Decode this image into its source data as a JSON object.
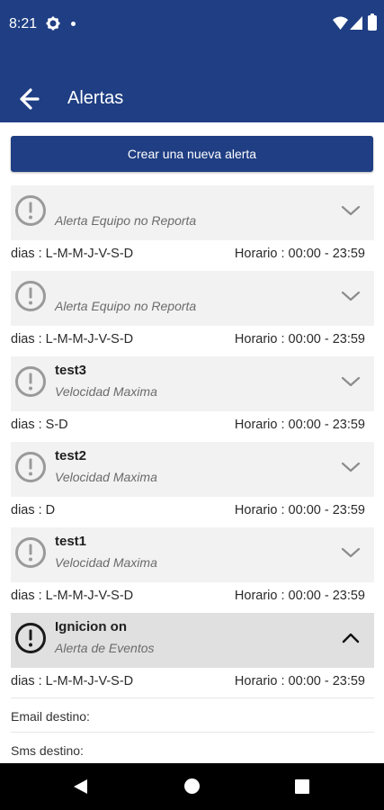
{
  "status_bar": {
    "time": "8:21"
  },
  "toolbar": {
    "title": "Alertas"
  },
  "create_button": {
    "label": "Crear una nueva alerta"
  },
  "alerts": [
    {
      "name": "",
      "type": "Alerta Equipo no Reporta",
      "days": "dias : L-M-M-J-V-S-D",
      "hours": "Horario : 00:00 - 23:59",
      "expanded": false
    },
    {
      "name": "",
      "type": "Alerta Equipo no Reporta",
      "days": "dias : L-M-M-J-V-S-D",
      "hours": "Horario : 00:00 - 23:59",
      "expanded": false
    },
    {
      "name": "test3",
      "type": "Velocidad Maxima",
      "days": "dias : S-D",
      "hours": "Horario : 00:00 - 23:59",
      "expanded": false
    },
    {
      "name": "test2",
      "type": "Velocidad Maxima",
      "days": "dias : D",
      "hours": "Horario : 00:00 - 23:59",
      "expanded": false
    },
    {
      "name": "test1",
      "type": "Velocidad Maxima",
      "days": "dias : L-M-M-J-V-S-D",
      "hours": "Horario : 00:00 - 23:59",
      "expanded": false
    },
    {
      "name": "Ignicion on",
      "type": "Alerta de Eventos",
      "days": "dias : L-M-M-J-V-S-D",
      "hours": "Horario : 00:00 - 23:59",
      "expanded": true
    }
  ],
  "expanded_details": {
    "email_label": "Email destino:",
    "sms_label": "Sms destino:"
  },
  "colors": {
    "primary": "#1f3e83",
    "row_bg": "#f2f2f2",
    "row_bg_expanded": "#e0e0e0"
  }
}
